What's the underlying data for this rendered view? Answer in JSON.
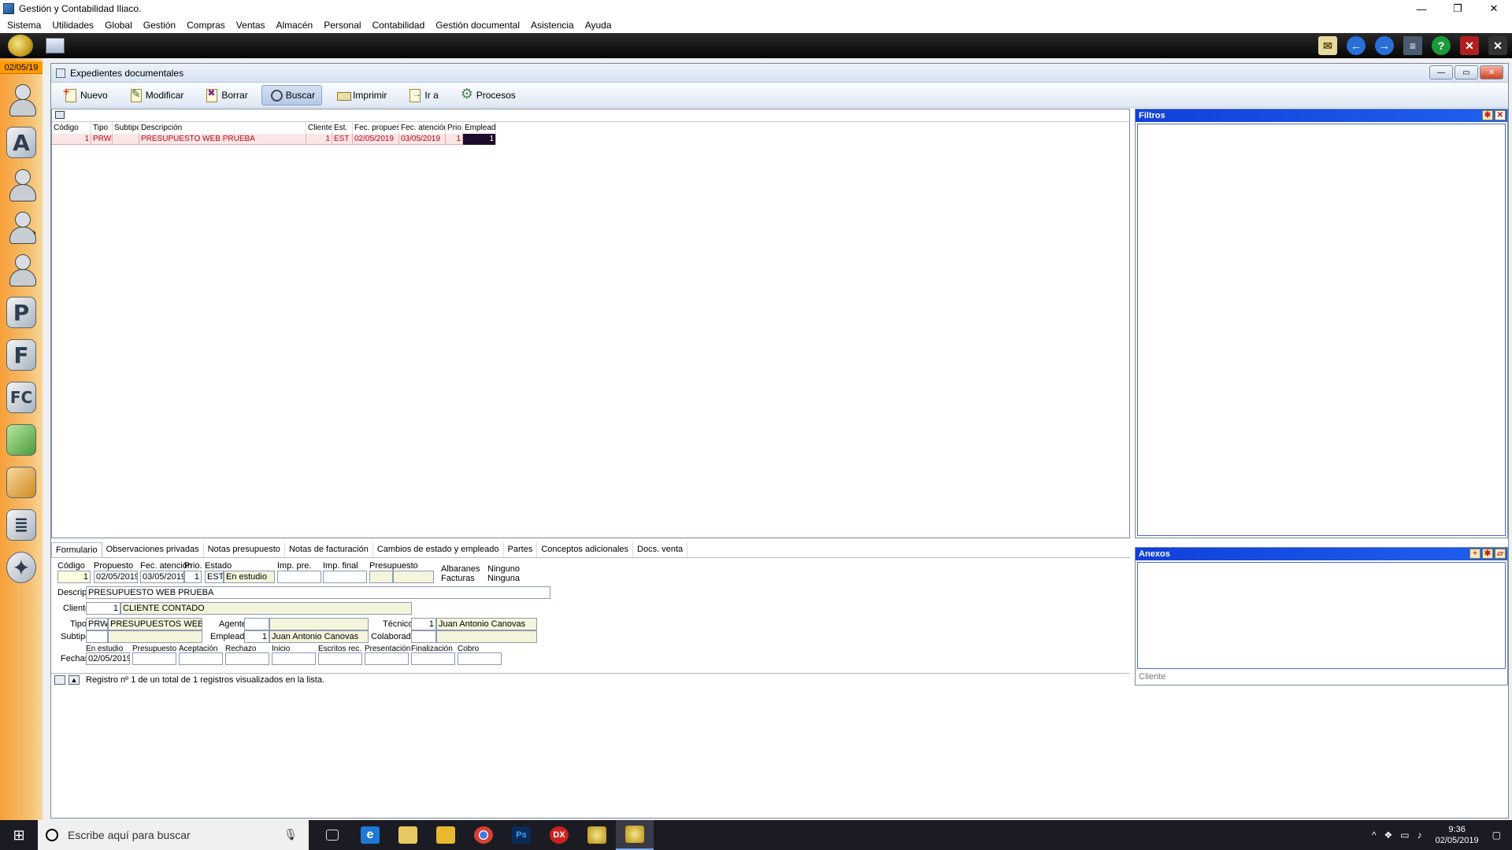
{
  "window": {
    "title": "Gestión y Contabilidad Iliaco."
  },
  "menu": [
    "Sistema",
    "Utilidades",
    "Global",
    "Gestión",
    "Compras",
    "Ventas",
    "Almacén",
    "Personal",
    "Contabilidad",
    "Gestión documental",
    "Asistencia",
    "Ayuda"
  ],
  "dock": {
    "date": "02/05/19"
  },
  "doc_window": {
    "title": "Expedientes documentales",
    "actions": [
      "Nuevo",
      "Modificar",
      "Borrar",
      "Buscar",
      "Imprimir",
      "Ir a",
      "Procesos"
    ]
  },
  "grid": {
    "columns": [
      "Código",
      "Tipo",
      "Subtipo",
      "Descripción",
      "Cliente",
      "Est.",
      "Fec. propues.",
      "Fec. atención",
      "Prio.",
      "Empleado"
    ],
    "rows": [
      [
        "1",
        "PRW",
        "",
        "PRESUPUESTO WEB PRUEBA",
        "1",
        "EST",
        "02/05/2019",
        "03/05/2019",
        "1",
        "1"
      ]
    ]
  },
  "filters": {
    "title": "Filtros"
  },
  "annexes": {
    "title": "Anexos",
    "footer": "Cliente"
  },
  "tabs": [
    "Formulario",
    "Observaciones privadas",
    "Notas presupuesto",
    "Notas de facturación",
    "Cambios de estado y empleado",
    "Partes",
    "Conceptos adicionales",
    "Docs. venta"
  ],
  "form": {
    "labels": {
      "codigo": "Código",
      "propuesto": "Propuesto",
      "fec_atencion": "Fec. atención",
      "prio": "Prio.",
      "estado": "Estado",
      "imp_pre": "Imp. pre.",
      "imp_final": "Imp. final",
      "presupuesto": "Presupuesto",
      "albaranes": "Albaranes",
      "facturas": "Facturas",
      "descrip": "Descrip.",
      "cliente": "Cliente",
      "tipo": "Tipo",
      "subtipo": "Subtipo",
      "agente": "Agente",
      "empleado": "Empleado",
      "tecnico": "Técnico",
      "colaborador": "Colaborador",
      "fechas": "Fechas"
    },
    "codigo": "1",
    "propuesto": "02/05/2019",
    "fec_atencion": "03/05/2019",
    "prio": "1",
    "estado_code": "EST",
    "estado_name": "En estudio",
    "albaranes_value": "Ninguno",
    "facturas_value": "Ninguna",
    "descrip": "PRESUPUESTO WEB PRUEBA",
    "cliente_code": "1",
    "cliente_name": "CLIENTE CONTADO",
    "tipo_code": "PRW",
    "tipo_name": "PRESUPUESTOS WEB",
    "empleado_code": "1",
    "empleado_name": "Juan Antonio Canovas",
    "tecnico_code": "1",
    "tecnico_name": "Juan Antonio Canovas",
    "date_labels": [
      "En estudio",
      "Presupuesto",
      "Aceptación",
      "Rechazo",
      "Inicio",
      "Escritos rec.",
      "Presentación",
      "Finalización",
      "Cobro"
    ],
    "date_values": [
      "02/05/2019",
      "",
      "",
      "",
      "",
      "",
      "",
      "",
      ""
    ]
  },
  "status": {
    "text": "Registro nº 1 de un total de 1 registros visualizados en la lista."
  },
  "taskbar": {
    "search_placeholder": "Escribe aquí para buscar",
    "apps": [
      {
        "icon": "task-view-icon",
        "label": ""
      },
      {
        "icon": "edge-icon",
        "label": "e"
      },
      {
        "icon": "mail-icon",
        "label": ""
      },
      {
        "icon": "explorer-icon",
        "label": ""
      },
      {
        "icon": "chrome-icon",
        "label": ""
      },
      {
        "icon": "photoshop-icon",
        "label": "Ps"
      },
      {
        "icon": "dx-icon",
        "label": "DX"
      },
      {
        "icon": "app-icon",
        "label": ""
      },
      {
        "icon": "app-active-icon",
        "label": ""
      }
    ],
    "time": "9:36",
    "date": "02/05/2019"
  }
}
